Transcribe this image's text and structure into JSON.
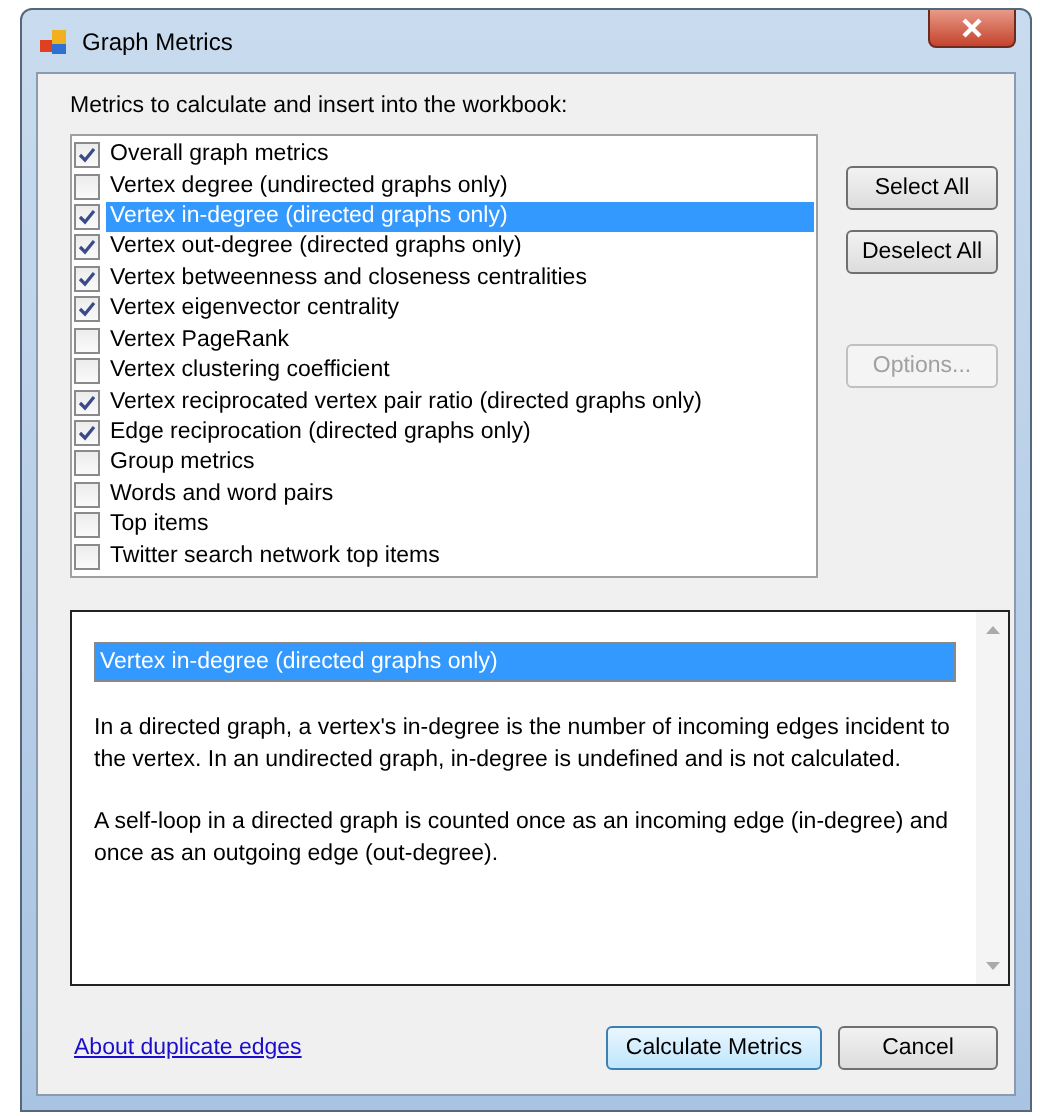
{
  "window": {
    "title": "Graph Metrics"
  },
  "list_label": "Metrics to calculate and insert into the workbook:",
  "metrics": [
    {
      "label": "Overall graph metrics",
      "checked": true,
      "selected": false
    },
    {
      "label": "Vertex degree (undirected graphs only)",
      "checked": false,
      "selected": false
    },
    {
      "label": "Vertex in-degree (directed graphs only)",
      "checked": true,
      "selected": true
    },
    {
      "label": "Vertex out-degree (directed graphs only)",
      "checked": true,
      "selected": false
    },
    {
      "label": "Vertex betweenness and closeness centralities",
      "checked": true,
      "selected": false
    },
    {
      "label": "Vertex eigenvector centrality",
      "checked": true,
      "selected": false
    },
    {
      "label": "Vertex PageRank",
      "checked": false,
      "selected": false
    },
    {
      "label": "Vertex clustering coefficient",
      "checked": false,
      "selected": false
    },
    {
      "label": "Vertex reciprocated vertex pair ratio (directed graphs only)",
      "checked": true,
      "selected": false
    },
    {
      "label": "Edge reciprocation (directed graphs only)",
      "checked": true,
      "selected": false
    },
    {
      "label": "Group metrics",
      "checked": false,
      "selected": false
    },
    {
      "label": "Words and word pairs",
      "checked": false,
      "selected": false
    },
    {
      "label": "Top items",
      "checked": false,
      "selected": false
    },
    {
      "label": "Twitter search network top items",
      "checked": false,
      "selected": false
    }
  ],
  "side_buttons": [
    {
      "label": "Select All",
      "disabled": false
    },
    {
      "label": "Deselect All",
      "disabled": false
    },
    {
      "label": "Options...",
      "disabled": true
    }
  ],
  "description": {
    "heading": "Vertex in-degree (directed graphs only)",
    "paragraphs": [
      "In a directed graph, a vertex's in-degree is the number of incoming edges incident to the vertex. In an undirected graph, in-degree is undefined and is not calculated.",
      "A self-loop in a directed graph is counted once as an incoming edge (in-degree) and once as an outgoing edge (out-degree)."
    ]
  },
  "link": "About duplicate edges",
  "buttons": [
    {
      "label": "Calculate Metrics",
      "default": true
    },
    {
      "label": "Cancel",
      "default": false
    }
  ]
}
